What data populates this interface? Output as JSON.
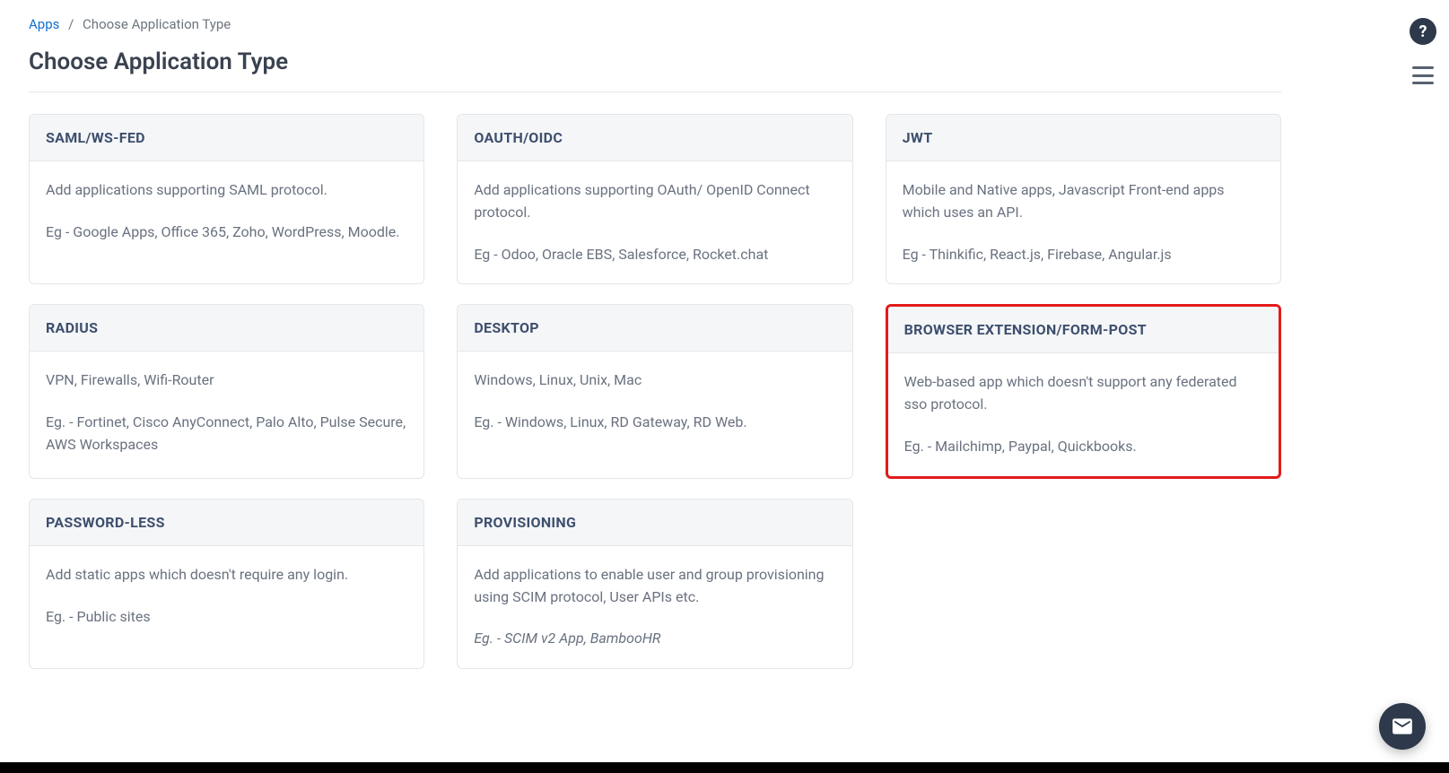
{
  "breadcrumb": {
    "root": "Apps",
    "current": "Choose Application Type"
  },
  "page_title": "Choose Application Type",
  "cards": [
    {
      "title": "SAML/WS-FED",
      "desc": "Add applications supporting SAML protocol.",
      "eg": "Eg - Google Apps, Office 365, Zoho, WordPress, Moodle.",
      "highlight": false
    },
    {
      "title": "OAUTH/OIDC",
      "desc": "Add applications supporting OAuth/ OpenID Connect protocol.",
      "eg": "Eg - Odoo, Oracle EBS, Salesforce, Rocket.chat",
      "highlight": false
    },
    {
      "title": "JWT",
      "desc": "Mobile and Native apps, Javascript Front-end apps which uses an API.",
      "eg": "Eg - Thinkific, React.js, Firebase, Angular.js",
      "highlight": false
    },
    {
      "title": "RADIUS",
      "desc": "VPN, Firewalls, Wifi-Router",
      "eg": "Eg. - Fortinet, Cisco AnyConnect, Palo Alto, Pulse Secure, AWS Workspaces",
      "highlight": false
    },
    {
      "title": "DESKTOP",
      "desc": "Windows, Linux, Unix, Mac",
      "eg": "Eg. - Windows, Linux, RD Gateway, RD Web.",
      "highlight": false
    },
    {
      "title": "BROWSER EXTENSION/FORM-POST",
      "desc": "Web-based app which doesn't support any federated sso protocol.",
      "eg": "Eg. - Mailchimp, Paypal, Quickbooks.",
      "highlight": true
    },
    {
      "title": "PASSWORD-LESS",
      "desc": "Add static apps which doesn't require any login.",
      "eg": "Eg. - Public sites",
      "highlight": false
    },
    {
      "title": "PROVISIONING",
      "desc": "Add applications to enable user and group provisioning using SCIM protocol, User APIs etc.",
      "eg": "Eg. - SCIM v2 App, BambooHR",
      "eg_italic": true,
      "highlight": false
    }
  ],
  "help_label": "?",
  "colors": {
    "highlight_border": "#e21b1b",
    "link": "#1170cf",
    "header_text": "#3d4f6e"
  }
}
